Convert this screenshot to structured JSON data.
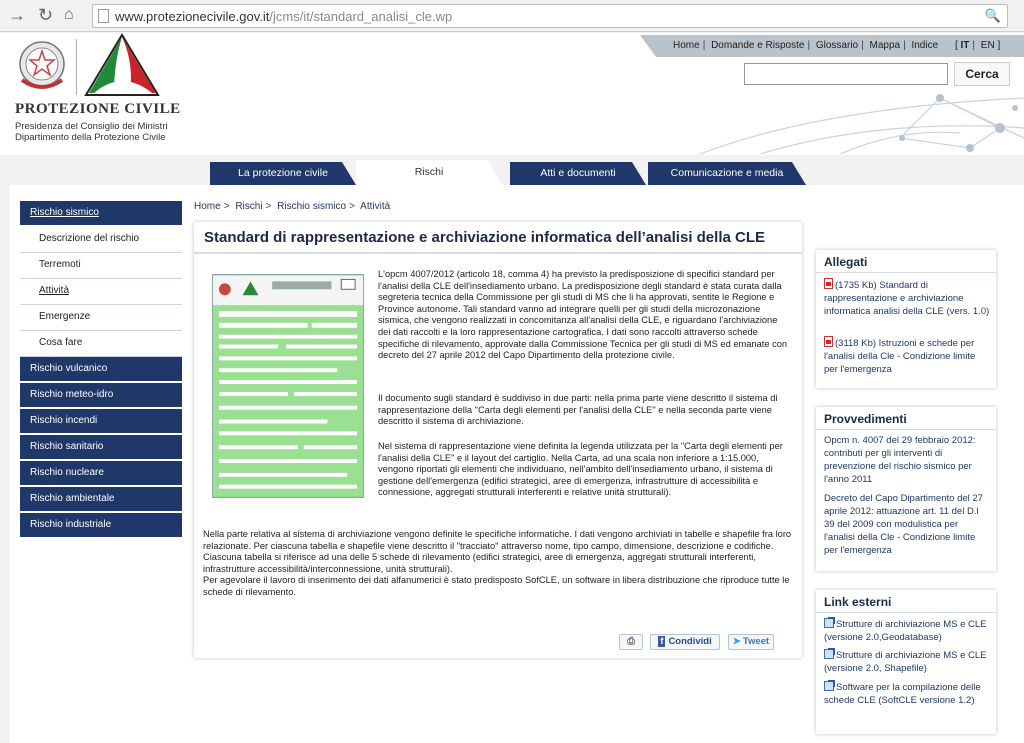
{
  "browser": {
    "url_domain": "www.protezionecivile.gov.it",
    "url_path": "/jcms/it/standard_analisi_cle.wp"
  },
  "header": {
    "brand": "PROTEZIONE CIVILE",
    "subline1": "Presidenza del Consiglio dei Ministri",
    "subline2": "Dipartimento della Protezione Civile",
    "toplinks": [
      "Home",
      "Domande e Risposte",
      "Glossario",
      "Mappa",
      "Indice"
    ],
    "lang_it": "IT",
    "lang_en": "EN",
    "search_button": "Cerca",
    "accent_color": "#1f3769"
  },
  "tabs": [
    {
      "label": "La protezione civile",
      "active": false
    },
    {
      "label": "Rischi",
      "active": true
    },
    {
      "label": "Atti e documenti",
      "active": false
    },
    {
      "label": "Comunicazione e media",
      "active": false
    }
  ],
  "sidebar": [
    {
      "label": "Rischio sismico",
      "type": "main",
      "underline": true
    },
    {
      "label": "Descrizione del rischio",
      "type": "sub"
    },
    {
      "label": "Terremoti",
      "type": "sub"
    },
    {
      "label": "Attività",
      "type": "sub",
      "underline": true
    },
    {
      "label": "Emergenze",
      "type": "sub"
    },
    {
      "label": "Cosa fare",
      "type": "sub"
    },
    {
      "label": "Rischio vulcanico",
      "type": "main"
    },
    {
      "label": "Rischio meteo-idro",
      "type": "main"
    },
    {
      "label": "Rischio incendi",
      "type": "main"
    },
    {
      "label": "Rischio sanitario",
      "type": "main"
    },
    {
      "label": "Rischio nucleare",
      "type": "main"
    },
    {
      "label": "Rischio ambientale",
      "type": "main"
    },
    {
      "label": "Rischio industriale",
      "type": "main"
    }
  ],
  "breadcrumb": [
    "Home",
    "Rischi",
    "Rischio sismico",
    "Attività"
  ],
  "article": {
    "title": "Standard di rappresentazione e archiviazione informatica dell’analisi della CLE",
    "p1": "L'opcm 4007/2012 (articolo 18, comma 4) ha previsto la predisposizione di specifici standard per l'analisi della CLE dell'insediamento urbano. La predisposizione degli standard è stata curata dalla segreteria tecnica della Commissione per gli studi di MS che li ha approvati, sentite le Regione e Province autonome. Tali standard vanno ad integrare quelli per gli studi della microzonazione sismica, che vengono realizzati in concomitanza all'analisi della CLE, e riguardano l'archiviazione dei dati raccolti e la loro rappresentazione cartografica. I dati sono raccolti attraverso schede specifiche di rilevamento, approvate dalla Commissione Tecnica per gli studi di MS ed emanate con decreto del 27 aprile 2012 del Capo Dipartimento della protezione civile.",
    "p2": "Il documento sugli standard è suddiviso in due parti: nella prima parte viene descritto il sistema di rappresentazione della \"Carta degli elementi per l'analisi della CLE\" e nella seconda parte viene descritto il sistema di archiviazione.",
    "p3": "Nel sistema di rappresentazione viene definita la legenda utilizzata per la \"Carta degli elementi per l'analisi della CLE\" e il layout del cartiglio. Nella Carta, ad una scala non inferiore a 1:15.000, vengono riportati gli elementi che individuano, nell'ambito dell'insediamento urbano, il sistema di gestione dell'emergenza (edifici strategici, aree di emergenza, infrastrutture di accessibilità e connessione, aggregati strutturali interferenti e relative unità strutturali).",
    "p4": "Nella parte relativa al sistema di archiviazione vengono definite le specifiche informatiche. I dati vengono archiviati in tabelle e shapefile fra loro relazionate. Per ciascuna tabella e shapefile viene descritto il \"tracciato\" attraverso nome, tipo campo, dimensione, descrizione e codifiche. Ciascuna tabella si riferisce ad una delle 5 schede di rilevamento (edifici strategici, aree di emergenza, aggregati strutturali interferenti, infrastrutture accessibilità/interconnessione, unità strutturali).",
    "p5": "Per agevolare il lavoro di inserimento dei dati alfanumerici è stato predisposto SofCLE, un software in libera distribuzione che riproduce tutte le schede di rilevamento.",
    "share_fb": "Condividi",
    "share_tw": "Tweet"
  },
  "allegati": {
    "title": "Allegati",
    "items": [
      "(1735 Kb) Standard di rappresentazione e archiviazione informatica analisi della CLE (vers. 1.0)",
      "(3118 Kb) Istruzioni e schede per l'analisi della Cle - Condizione limite per l'emergenza"
    ]
  },
  "provvedimenti": {
    "title": "Provvedimenti",
    "items": [
      "Opcm n. 4007 del 29 febbraio 2012: contributi per gli interventi di prevenzione del rischio sismico per l'anno 2011",
      "Decreto del Capo Dipartimento del 27 aprile 2012: attuazione art. 11 del D.l 39 del 2009 con modulistica per l'analisi della Cle - Condizione limite per l'emergenza"
    ]
  },
  "links": {
    "title": "Link esterni",
    "items": [
      "Strutture di archiviazione MS e CLE (versione 2.0,Geodatabase)",
      "Strutture di archiviazione MS e CLE (versione 2.0, Shapefile)",
      "Software per la compilazione delle schede CLE (SoftCLE versione 1.2)"
    ]
  }
}
